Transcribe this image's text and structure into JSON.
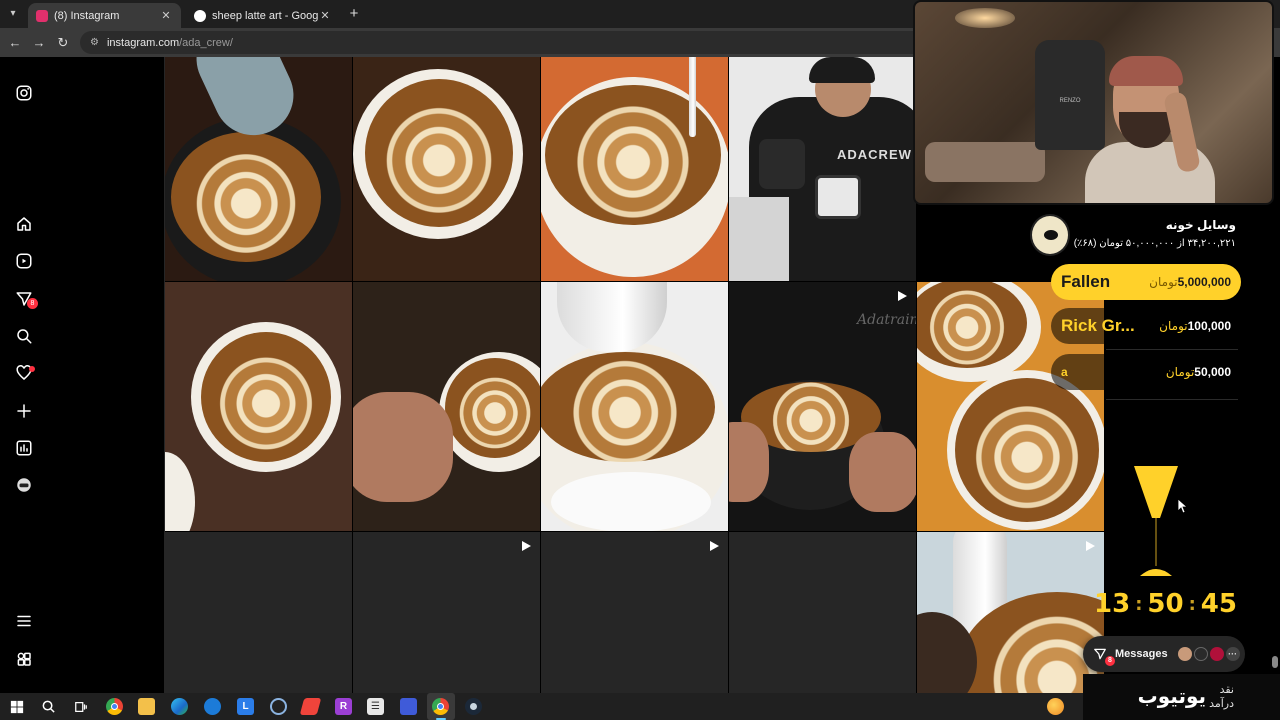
{
  "browser": {
    "tabs": [
      {
        "title": "(8) Instagram",
        "active": true,
        "favicon_color": "#e1306c"
      },
      {
        "title": "sheep latte art - Google Search",
        "active": false,
        "favicon_color": "#4285f4"
      }
    ],
    "new_tab_label": "+",
    "url_host": "instagram.com",
    "url_path": "/ada_crew/"
  },
  "instagram": {
    "sidebar_icons": [
      "instagram-icon",
      "home-icon",
      "reels-icon",
      "messages-icon",
      "search-icon",
      "notifications-icon",
      "create-icon",
      "dashboard-icon",
      "profile-icon",
      "more-icon",
      "meta-apps-icon"
    ],
    "messages_badge": "8",
    "posts": [
      {
        "kind": "latte",
        "reel": false
      },
      {
        "kind": "latte",
        "reel": false
      },
      {
        "kind": "latte",
        "reel": false
      },
      {
        "kind": "barista",
        "reel": false
      },
      {
        "kind": "latte",
        "reel": false
      },
      {
        "kind": "latte",
        "reel": false
      },
      {
        "kind": "latte",
        "reel": false
      },
      {
        "kind": "latte",
        "reel": true
      },
      {
        "kind": "latte",
        "reel": false
      },
      {
        "kind": "latte",
        "reel": false
      },
      {
        "kind": "empty",
        "reel": true
      },
      {
        "kind": "empty",
        "reel": true
      },
      {
        "kind": "empty",
        "reel": false
      },
      {
        "kind": "latte",
        "reel": true
      }
    ],
    "watermark": "Adatrain"
  },
  "webcam": {
    "chair_brand": "RENZO"
  },
  "donation_goal": {
    "title": "وسایل خونه",
    "progress": "۳۴,۲۰۰,۲۲۱ از ۵۰,۰۰۰,۰۰۰ تومان (۶۸٪)"
  },
  "donors": [
    {
      "name": "Fallen",
      "amount": "5,000,000",
      "unit": "تومان",
      "top": true
    },
    {
      "name": "Rick Gr...",
      "amount": "100,000",
      "unit": "تومان",
      "top": false
    },
    {
      "name": "a",
      "amount": "50,000",
      "unit": "تومان",
      "top": false
    }
  ],
  "timer": {
    "hours": "13",
    "minutes": "50",
    "seconds": "45"
  },
  "messages_widget": {
    "label": "Messages",
    "badge": "8",
    "more": "···"
  },
  "stream_sign": {
    "main": "یوتیوب",
    "line1": "نقد",
    "line2": "درآمد"
  },
  "taskbar_icons": [
    "windows-start-icon",
    "search-icon",
    "task-view-icon",
    "chrome-icon",
    "file-explorer-icon",
    "edge-icon",
    "sharex-icon",
    "lightshot-icon",
    "obs-icon",
    "anydesk-icon",
    "rider-icon",
    "notepad-icon",
    "streamlabs-icon",
    "chrome-active-icon",
    "steam-icon"
  ],
  "colors": {
    "accent_yellow": "#ffd12a",
    "ig_badge": "#ff3040"
  }
}
